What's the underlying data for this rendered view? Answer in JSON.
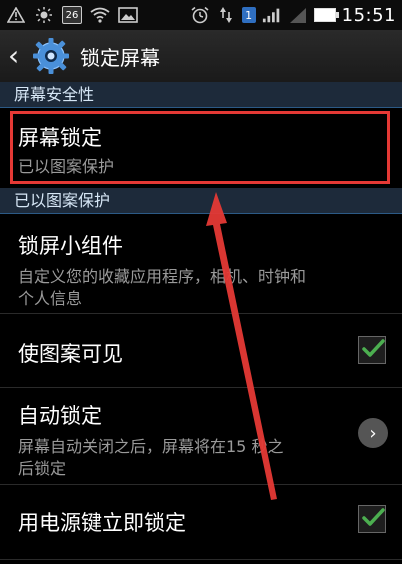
{
  "status_bar": {
    "calendar_day": "26",
    "sim_slot": "1",
    "time": "15:51",
    "icons": [
      "warning-icon",
      "brightness-icon",
      "calendar-icon",
      "wifi-icon",
      "image-icon",
      "alarm-icon",
      "data-transfer-icon",
      "sim-icon",
      "signal-icon",
      "battery-icon"
    ]
  },
  "action_bar": {
    "title": "锁定屏幕"
  },
  "sections": {
    "screen_security": "屏幕安全性",
    "pattern_protected": "已以图案保护"
  },
  "items": {
    "screen_lock": {
      "title": "屏幕锁定",
      "subtitle": "已以图案保护"
    },
    "lock_widgets": {
      "title": "锁屏小组件",
      "subtitle_line1": "自定义您的收藏应用程序，相机、时钟和",
      "subtitle_line2": "个人信息"
    },
    "pattern_visible": {
      "title": "使图案可见",
      "checked": true
    },
    "auto_lock": {
      "title": "自动锁定",
      "subtitle_line1": "屏幕自动关闭之后，屏幕将在15 秒之",
      "subtitle_line2": "后锁定"
    },
    "power_key_lock": {
      "title": "用电源键立即锁定",
      "checked": true
    }
  },
  "colors": {
    "highlight": "#e53935",
    "check": "#4caf50",
    "section_bg": "#1d2a3a"
  }
}
